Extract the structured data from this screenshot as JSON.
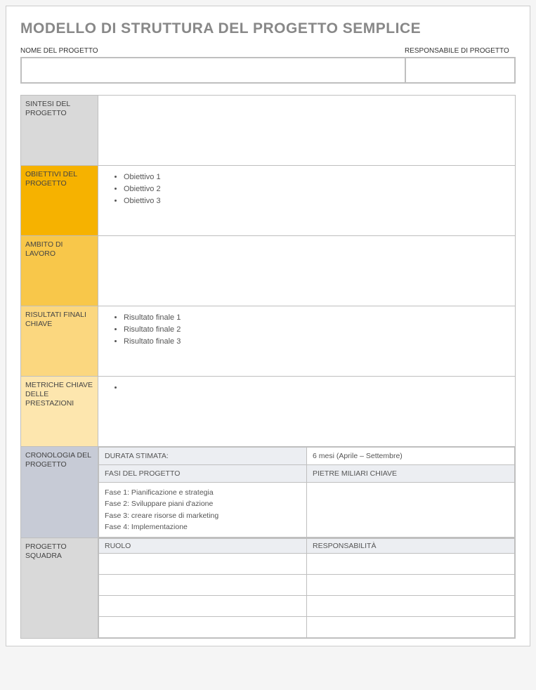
{
  "title": "MODELLO DI STRUTTURA DEL PROGETTO SEMPLICE",
  "header": {
    "project_name_label": "NOME DEL PROGETTO",
    "project_manager_label": "RESPONSABILE DI PROGETTO"
  },
  "sections": {
    "summary_label": "SINTESI DEL PROGETTO",
    "objectives_label": "OBIETTIVI DEL PROGETTO",
    "objectives": [
      "Obiettivo 1",
      "Obiettivo 2",
      "Obiettivo 3"
    ],
    "scope_label": "AMBITO DI LAVORO",
    "deliverables_label": "RISULTATI FINALI CHIAVE",
    "deliverables": [
      "Risultato finale 1",
      "Risultato finale 2",
      "Risultato finale 3"
    ],
    "kpis_label": "METRICHE CHIAVE DELLE PRESTAZIONI",
    "kpis": [
      ""
    ],
    "timeline_label": "CRONOLOGIA DEL PROGETTO",
    "timeline": {
      "duration_label": "DURATA STIMATA:",
      "duration_value": "6 mesi (Aprile – Settembre)",
      "phases_header": "FASI DEL PROGETTO",
      "milestones_header": "PIETRE MILIARI CHIAVE",
      "phases": [
        "Fase 1:  Pianificazione e strategia",
        "Fase 2:  Sviluppare piani d'azione",
        "Fase 3:  creare risorse di marketing",
        "Fase 4:  Implementazione"
      ]
    },
    "team_label": "PROGETTO SQUADRA",
    "team": {
      "role_header": "RUOLO",
      "responsibility_header": "RESPONSABILITÀ",
      "rows": 4
    }
  }
}
